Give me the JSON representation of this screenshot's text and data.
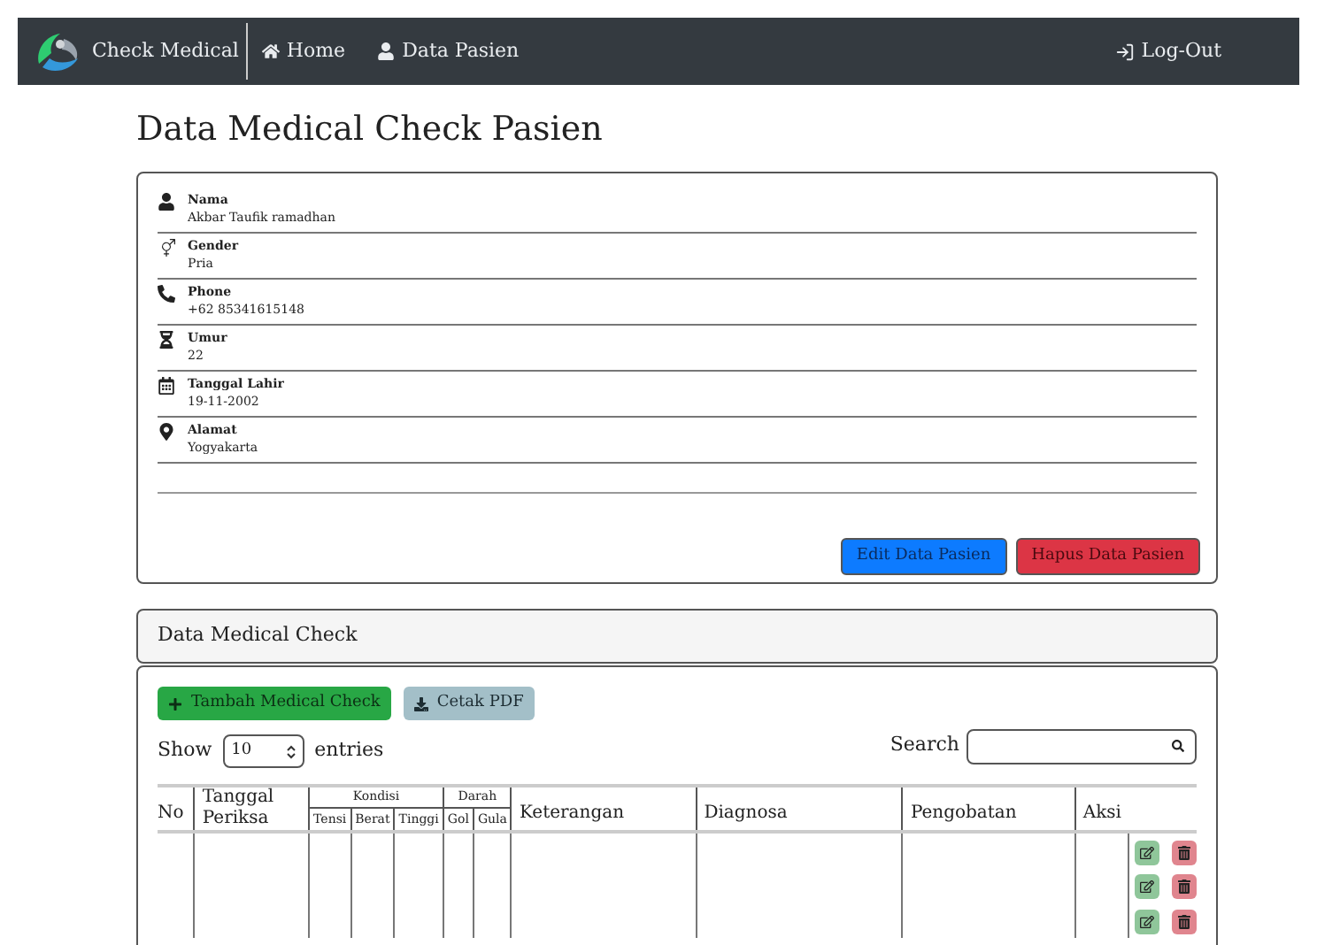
{
  "navbar": {
    "brand": "Check Medical",
    "links": [
      {
        "kind": "home",
        "label": "Home"
      },
      {
        "kind": "user",
        "label": "Data Pasien"
      }
    ],
    "logout": "Log-Out"
  },
  "title": "Data Medical Check Pasien",
  "patient": {
    "fields": [
      {
        "kind": "user",
        "label": "Nama",
        "value": "Akbar Taufik ramadhan"
      },
      {
        "kind": "gender",
        "label": "Gender",
        "value": "Pria"
      },
      {
        "kind": "phone",
        "label": "Phone",
        "value": "+62 85341615148"
      },
      {
        "kind": "hourglass",
        "label": "Umur",
        "value": "22"
      },
      {
        "kind": "calendar",
        "label": "Tanggal Lahir",
        "value": "19-11-2002"
      },
      {
        "kind": "pin",
        "label": "Alamat",
        "value": "Yogyakarta"
      }
    ],
    "buttons": [
      {
        "kind": "primary",
        "label": "Edit Data Pasien"
      },
      {
        "kind": "danger",
        "label": "Hapus Data Pasien"
      }
    ]
  },
  "medical": {
    "header": "Data Medical Check",
    "buttons": [
      {
        "kind": "add",
        "label": "Tambah Medical Check"
      },
      {
        "kind": "pdf",
        "label": "Cetak PDF"
      }
    ],
    "show_label": "Show",
    "page_size": "10",
    "entries_label": "entries",
    "search_label": "Search",
    "table": {
      "no": "No",
      "tanggal": "Tanggal Periksa",
      "kondisi": {
        "label": "Kondisi",
        "columns": [
          "Tensi",
          "Berat",
          "Tinggi"
        ]
      },
      "darah": {
        "label": "Darah",
        "columns": [
          "Gol",
          "Gula"
        ]
      },
      "keterangan": "Keterangan",
      "diagnosa": "Diagnosa",
      "pengobatan": "Pengobatan",
      "aksi": "Aksi"
    },
    "rows": [
      {
        "actions": [
          {
            "kind": "edit"
          },
          {
            "kind": "delete"
          }
        ]
      },
      {
        "actions": [
          {
            "kind": "edit"
          },
          {
            "kind": "delete"
          }
        ]
      },
      {
        "actions": [
          {
            "kind": "edit"
          },
          {
            "kind": "delete"
          }
        ]
      }
    ]
  }
}
